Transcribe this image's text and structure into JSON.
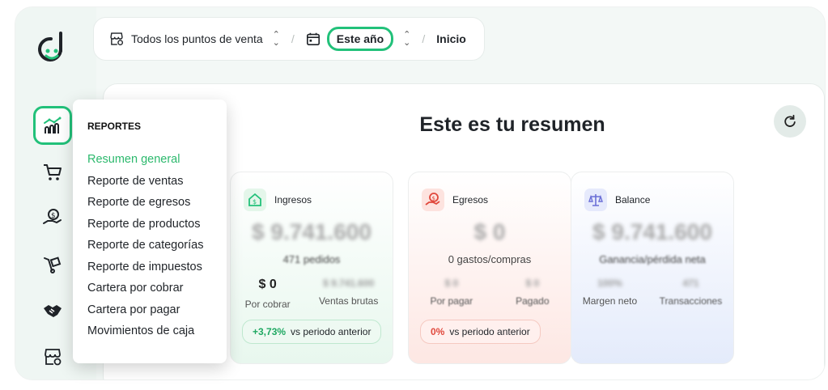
{
  "topbar": {
    "location": "Todos los puntos de venta",
    "period": "Este año",
    "breadcrumb": "Inicio"
  },
  "main": {
    "title": "Este es tu resumen"
  },
  "cards": {
    "ingresos": {
      "title": "Ingresos",
      "amount": "$ 9.741.600",
      "sub": "471 pedidos",
      "stat1_value": "$ 0",
      "stat1_label": "Por cobrar",
      "stat2_value": "$ 9.741.600",
      "stat2_label": "Ventas brutas",
      "change": "+3,73%",
      "change_text": "vs periodo anterior"
    },
    "egresos": {
      "title": "Egresos",
      "amount": "$ 0",
      "sub": "0 gastos/compras",
      "stat1_value": "$ 0",
      "stat1_label": "Por pagar",
      "stat2_value": "$ 0",
      "stat2_label": "Pagado",
      "change": "0%",
      "change_text": "vs periodo anterior"
    },
    "balance": {
      "title": "Balance",
      "amount": "$ 9.741.600",
      "sub": "Ganancia/pérdida neta",
      "stat1_value": "100%",
      "stat1_label": "Margen neto",
      "stat2_value": "471",
      "stat2_label": "Transacciones"
    }
  },
  "dropdown": {
    "title": "REPORTES",
    "items": [
      "Resumen general",
      "Reporte de ventas",
      "Reporte de egresos",
      "Reporte de productos",
      "Reporte de categorías",
      "Reporte de impuestos",
      "Cartera por cobrar",
      "Cartera por pagar",
      "Movimientos de caja"
    ]
  },
  "colors": {
    "accent": "#22c17a",
    "positive": "#1fa862",
    "negative": "#e0483c"
  },
  "icons": [
    "logo-icon",
    "reports-chart-icon",
    "cart-icon",
    "money-hand-icon",
    "hand-truck-icon",
    "handshake-icon",
    "store-location-icon",
    "calendar-icon",
    "refresh-icon"
  ]
}
